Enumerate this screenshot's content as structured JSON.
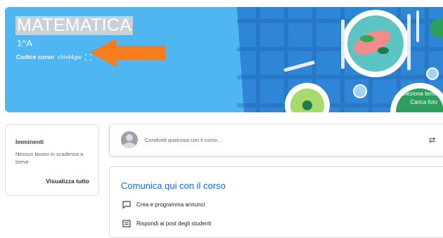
{
  "banner": {
    "title": "MATEMATICA",
    "section": "1^A",
    "code_label": "Codice corso",
    "code_value": "cfm44gw",
    "select_theme": "Seleziona tema",
    "upload_photo": "Carica foto",
    "colors": {
      "banner": "#4fb6f2",
      "arrow": "#f57c1f"
    }
  },
  "upcoming": {
    "title": "Imminenti",
    "empty_text": "Nessun lavoro in scadenza a breve",
    "view_all": "Visualizza tutto"
  },
  "share": {
    "placeholder": "Condividi qualcosa con il corso..."
  },
  "communicate": {
    "title": "Comunica qui con il corso",
    "items": [
      {
        "label": "Crea e programma annunci",
        "icon": "announcement-icon"
      },
      {
        "label": "Rispondi ai post degli studenti",
        "icon": "reply-icon"
      }
    ]
  }
}
